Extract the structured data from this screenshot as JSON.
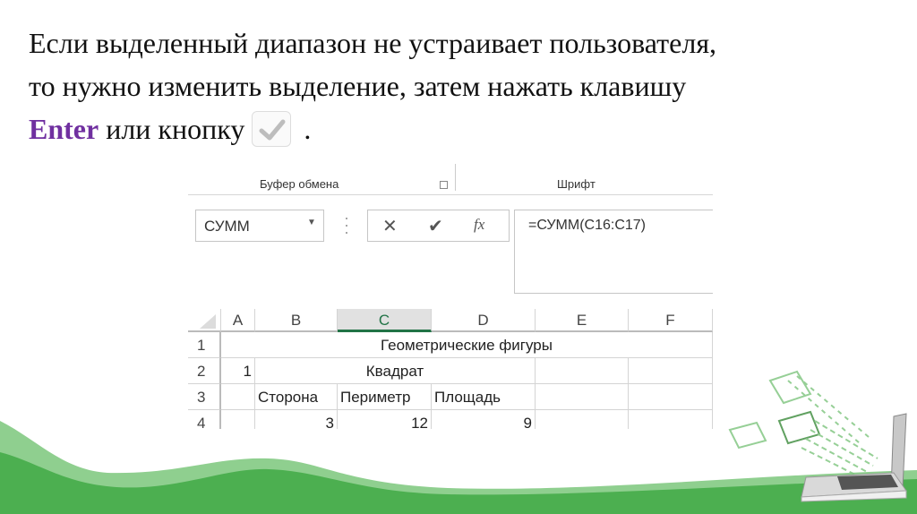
{
  "slide": {
    "line1": "Если выделенный диапазон не устраивает пользователя,",
    "line2": "то нужно изменить выделение, затем нажать клавишу",
    "line3_key": "Enter",
    "line3_rest": " или кнопку",
    "line3_end": "."
  },
  "ribbon": {
    "clipboard": "Буфер обмена",
    "font": "Шрифт"
  },
  "name_box": {
    "value": "СУММ"
  },
  "formula_bar": {
    "cancel": "✕",
    "enter": "✔",
    "fx": "fx",
    "value": "=СУММ(C16:C17)"
  },
  "columns": [
    "A",
    "B",
    "C",
    "D",
    "E",
    "F"
  ],
  "rows": [
    {
      "num": "1",
      "title": "Геометрические фигуры"
    },
    {
      "num": "2",
      "a": "1",
      "b": "Квадрат"
    },
    {
      "num": "3",
      "b": "Сторона",
      "c": "Периметр",
      "d": "Площадь"
    },
    {
      "num": "4",
      "b": "3",
      "c": "12",
      "d": "9"
    }
  ],
  "colors": {
    "accent": "#7030a0",
    "green": "#4caf50",
    "excel_green": "#217346"
  }
}
